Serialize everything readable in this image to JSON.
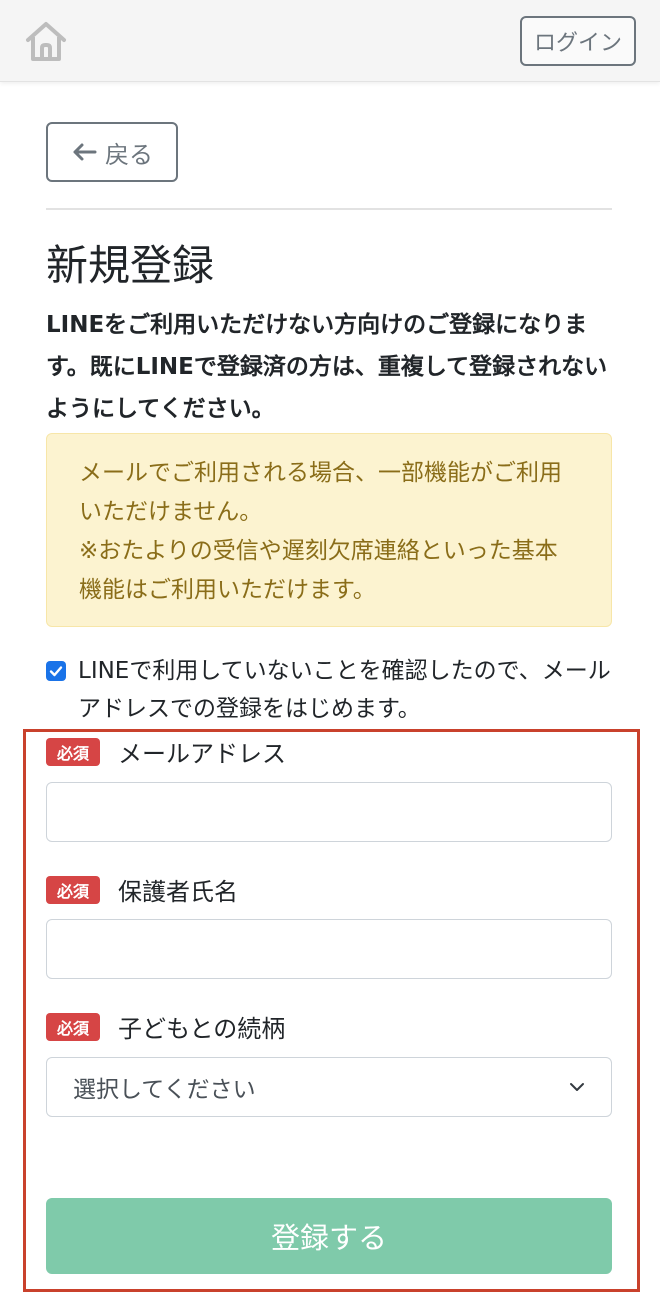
{
  "header": {
    "home_icon": "home-icon",
    "login_label": "ログイン"
  },
  "nav": {
    "back_icon": "arrow-left-icon",
    "back_label": "戻る"
  },
  "page": {
    "title": "新規登録",
    "lead": "LINEをご利用いただけない方向けのご登録になります。既にLINEで登録済の方は、重複して登録されないようにしてください。"
  },
  "warning": {
    "line1": "メールでご利用される場合、一部機能がご利用いただけません。",
    "line2": "※おたよりの受信や遅刻欠席連絡といった基本機能はご利用いただけます。"
  },
  "confirm": {
    "checked": true,
    "label": "LINEで利用していないことを確認したので、メールアドレスでの登録をはじめます。"
  },
  "form": {
    "required_badge": "必須",
    "email": {
      "label": "メールアドレス",
      "value": "",
      "placeholder": ""
    },
    "guardian_name": {
      "label": "保護者氏名",
      "value": "",
      "placeholder": ""
    },
    "relationship": {
      "label": "子どもとの続柄",
      "selected": "選択してください",
      "icon": "chevron-down-icon"
    },
    "submit_label": "登録する"
  },
  "colors": {
    "header_bg": "#f5f5f5",
    "warning_bg": "#fcf3d0",
    "warning_text": "#8a6d19",
    "required_badge": "#d64545",
    "submit_button": "#7fcaaa",
    "checkbox": "#1a73e8",
    "highlight_frame": "#c9412c"
  }
}
